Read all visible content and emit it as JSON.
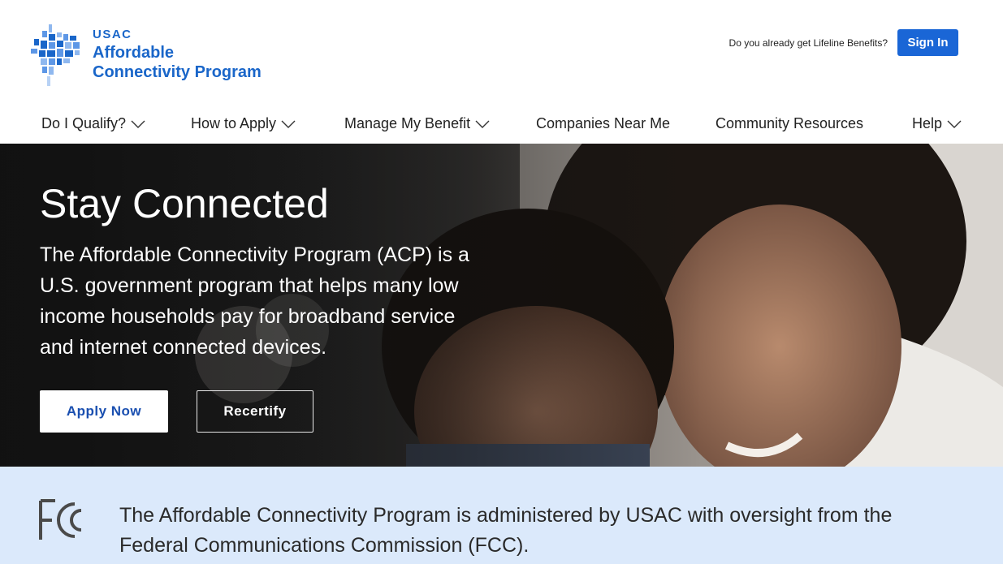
{
  "header": {
    "logo": {
      "org": "USAC",
      "program_line1": "Affordable",
      "program_line2": "Connectivity Program"
    },
    "lifeline_question": "Do you already get Lifeline Benefits?",
    "signin_label": "Sign In"
  },
  "nav": {
    "items": [
      {
        "label": "Do I Qualify?",
        "has_dropdown": true
      },
      {
        "label": "How to Apply",
        "has_dropdown": true
      },
      {
        "label": "Manage My Benefit",
        "has_dropdown": true
      },
      {
        "label": "Companies Near Me",
        "has_dropdown": false
      },
      {
        "label": "Community Resources",
        "has_dropdown": false
      },
      {
        "label": "Help",
        "has_dropdown": true
      }
    ]
  },
  "hero": {
    "title": "Stay Connected",
    "description": "The Affordable Connectivity Program (ACP) is a U.S. government program that helps many low income households pay for broadband service and internet connected devices.",
    "apply_label": "Apply Now",
    "recertify_label": "Recertify"
  },
  "banner": {
    "logo_text": "FCC",
    "text": "The Affordable Connectivity Program is administered by USAC with oversight from the Federal Communications Commission (FCC)."
  },
  "colors": {
    "brand_blue": "#1a66c9",
    "signin_blue": "#1a66d6",
    "banner_bg": "#dbe9fb"
  }
}
